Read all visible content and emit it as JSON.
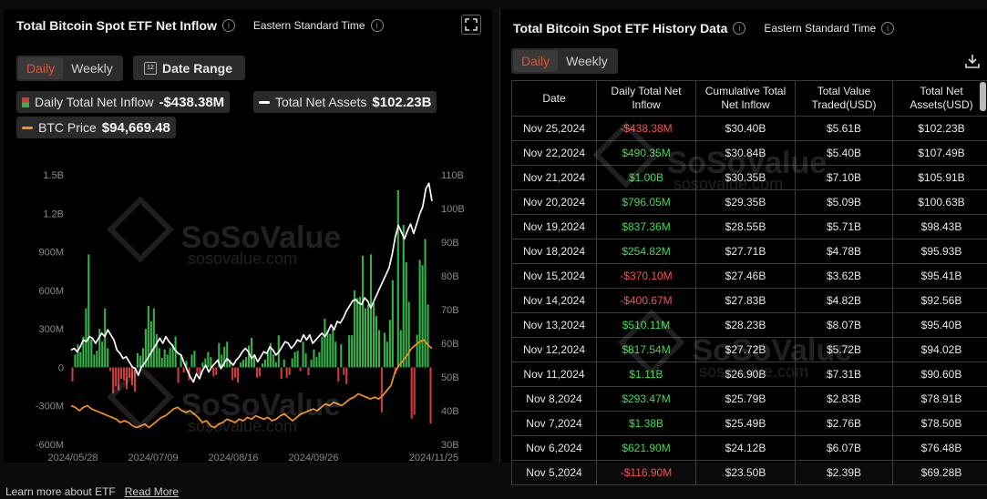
{
  "left": {
    "title": "Total Bitcoin Spot ETF Net Inflow",
    "timezone": "Eastern Standard Time",
    "tabs": [
      "Daily",
      "Weekly"
    ],
    "date_range_label": "Date Range",
    "legend": {
      "inflow_label": "Daily Total Net Inflow",
      "inflow_value": "-$438.38M",
      "assets_label": "Total Net Assets",
      "assets_value": "$102.23B",
      "btc_label": "BTC Price",
      "btc_value": "$94,669.48"
    },
    "watermark_name": "SoSoValue",
    "watermark_url": "sosovalue.com"
  },
  "right": {
    "title": "Total Bitcoin Spot ETF History Data",
    "timezone": "Eastern Standard Time",
    "tabs": [
      "Daily",
      "Weekly"
    ],
    "columns": [
      "Date",
      "Daily Total Net Inflow",
      "Cumulative Total Net Inflow",
      "Total Value Traded(USD)",
      "Total Net Assets(USD)"
    ],
    "rows": [
      [
        "Nov 25,2024",
        "-$438.38M",
        "$30.40B",
        "$5.61B",
        "$102.23B"
      ],
      [
        "Nov 22,2024",
        "$490.35M",
        "$30.84B",
        "$5.40B",
        "$107.49B"
      ],
      [
        "Nov 21,2024",
        "$1.00B",
        "$30.35B",
        "$7.10B",
        "$105.91B"
      ],
      [
        "Nov 20,2024",
        "$796.05M",
        "$29.35B",
        "$5.09B",
        "$100.63B"
      ],
      [
        "Nov 19,2024",
        "$837.36M",
        "$28.55B",
        "$5.71B",
        "$98.43B"
      ],
      [
        "Nov 18,2024",
        "$254.82M",
        "$27.71B",
        "$4.78B",
        "$95.93B"
      ],
      [
        "Nov 15,2024",
        "-$370.10M",
        "$27.46B",
        "$3.62B",
        "$95.41B"
      ],
      [
        "Nov 14,2024",
        "-$400.67M",
        "$27.83B",
        "$4.82B",
        "$92.56B"
      ],
      [
        "Nov 13,2024",
        "$510.11M",
        "$28.23B",
        "$8.07B",
        "$95.40B"
      ],
      [
        "Nov 12,2024",
        "$817.54M",
        "$27.72B",
        "$5.72B",
        "$94.02B"
      ],
      [
        "Nov 11,2024",
        "$1.11B",
        "$26.90B",
        "$7.31B",
        "$90.60B"
      ],
      [
        "Nov 8,2024",
        "$293.47M",
        "$25.79B",
        "$2.83B",
        "$78.91B"
      ],
      [
        "Nov 7,2024",
        "$1.38B",
        "$25.49B",
        "$2.76B",
        "$78.50B"
      ],
      [
        "Nov 6,2024",
        "$621.90M",
        "$24.12B",
        "$6.07B",
        "$76.48B"
      ],
      [
        "Nov 5,2024",
        "-$116.90M",
        "$23.50B",
        "$2.39B",
        "$69.28B"
      ]
    ]
  },
  "footer": {
    "text": "Learn more about ETF",
    "link": "Read More"
  },
  "colors": {
    "inflow_positive": "#35b34a",
    "inflow_negative": "#d23b3b",
    "net_assets_line": "#ffffff",
    "btc_price_line": "#f7931a",
    "accent": "#e8502f"
  },
  "chart_data": {
    "type": "bar",
    "title": "Total Bitcoin Spot ETF Net Inflow",
    "x_tick_labels": [
      "2024/05/28",
      "2024/07/09",
      "2024/08/16",
      "2024/09/26",
      "2024/11/25"
    ],
    "y_left_ticks": [
      "1.5B",
      "1.2B",
      "900M",
      "600M",
      "300M",
      "0",
      "-300M",
      "-600M"
    ],
    "y_left_range": [
      -600,
      1500
    ],
    "y_left_unit": "M USD",
    "y_right_ticks": [
      "110B",
      "100B",
      "90B",
      "80B",
      "70B",
      "60B",
      "50B",
      "40B",
      "30B"
    ],
    "y_right_range": [
      30,
      110
    ],
    "y_right_unit": "B USD",
    "series": [
      {
        "name": "Daily Total Net Inflow",
        "type": "bar",
        "axis": "left",
        "values": [
          -110,
          100,
          180,
          120,
          240,
          460,
          880,
          220,
          100,
          130,
          300,
          200,
          460,
          150,
          -30,
          -200,
          -150,
          -180,
          -90,
          -100,
          -170,
          -80,
          -140,
          -190,
          110,
          90,
          150,
          300,
          480,
          360,
          460,
          260,
          150,
          75,
          140,
          100,
          150,
          180,
          240,
          -120,
          100,
          -40,
          50,
          -100,
          100,
          130,
          -40,
          -60,
          40,
          70,
          120,
          80,
          -70,
          -60,
          190,
          100,
          160,
          200,
          60,
          -100,
          -80,
          -120,
          40,
          60,
          80,
          170,
          230,
          100,
          -80,
          -70,
          30,
          60,
          120,
          190,
          100,
          40,
          250,
          -90,
          60,
          -80,
          -60,
          70,
          120,
          130,
          -30,
          200,
          110,
          -60,
          60,
          140,
          80,
          120,
          240,
          380,
          290,
          260,
          300,
          200,
          -110,
          180,
          -60,
          -130,
          250,
          250,
          600,
          540,
          550,
          870,
          460,
          490,
          880,
          500,
          400,
          290,
          -350,
          270,
          200,
          370,
          680,
          -50,
          1380,
          290,
          1110,
          820,
          510,
          -400,
          -370,
          255,
          837,
          796,
          1000,
          490,
          -438
        ]
      },
      {
        "name": "Total Net Assets",
        "type": "line",
        "axis": "right",
        "values": [
          58,
          58.5,
          57.5,
          59,
          61,
          60.5,
          62,
          61.5,
          60,
          61.5,
          63,
          62,
          64,
          62.5,
          61,
          58,
          57,
          55.5,
          56,
          54.5,
          53,
          52.5,
          50.5,
          53,
          54,
          55.5,
          57,
          58.5,
          60,
          61.5,
          60,
          62,
          60.5,
          59.5,
          58,
          57,
          56.5,
          54,
          52,
          50,
          48.5,
          51,
          49.5,
          52,
          53.5,
          51.5,
          53,
          54,
          55,
          52.5,
          54,
          55.5,
          54.5,
          53.5,
          55,
          56,
          57.5,
          58.5,
          57.5,
          55.5,
          56.5,
          54.5,
          56,
          57.5,
          57,
          59,
          58,
          56.5,
          57.5,
          59,
          60.5,
          60,
          58.5,
          59.5,
          61,
          60.5,
          62.5,
          61,
          62.5,
          60,
          61,
          62,
          63,
          62,
          63.5,
          65.5,
          64,
          66.5,
          66,
          67.5,
          69.5,
          71,
          72.5,
          73,
          72,
          71.5,
          73.5,
          72.5,
          70.5,
          72.5,
          74.5,
          76.5,
          78.5,
          80.5,
          82.5,
          86.5,
          91.5,
          95,
          93,
          91,
          93.5,
          95.4,
          92.6,
          95.4,
          98.4,
          100.6,
          105.9,
          107.5,
          102.2
        ]
      },
      {
        "name": "BTC Price",
        "type": "line",
        "axis": "right",
        "values": [
          41.5,
          41,
          40,
          41,
          41.5,
          40.5,
          40,
          39.5,
          39,
          38.5,
          38,
          37.5,
          36.5,
          37,
          36.5,
          35.5,
          35,
          35.5,
          36,
          35,
          36,
          37,
          38,
          38.5,
          39.5,
          40.5,
          41,
          40,
          39.5,
          40,
          39,
          38,
          36.5,
          37,
          35.5,
          35,
          36,
          36.5,
          37.5,
          37,
          36.5,
          37.5,
          37,
          38,
          37.5,
          38.5,
          38,
          37.5,
          38,
          37,
          37.5,
          38.5,
          39,
          38,
          37,
          38,
          39,
          39.5,
          40,
          40.5,
          40,
          41,
          42,
          41.5,
          42.5,
          42,
          41.5,
          42.5,
          43.5,
          44,
          45,
          44.5,
          44,
          43.5,
          44,
          43.5,
          44.5,
          46,
          47.5,
          51.5,
          53.5,
          55,
          56.5,
          58.5,
          59.5,
          60.5,
          61,
          59.5,
          58.5
        ]
      }
    ],
    "legend_position": "top"
  }
}
